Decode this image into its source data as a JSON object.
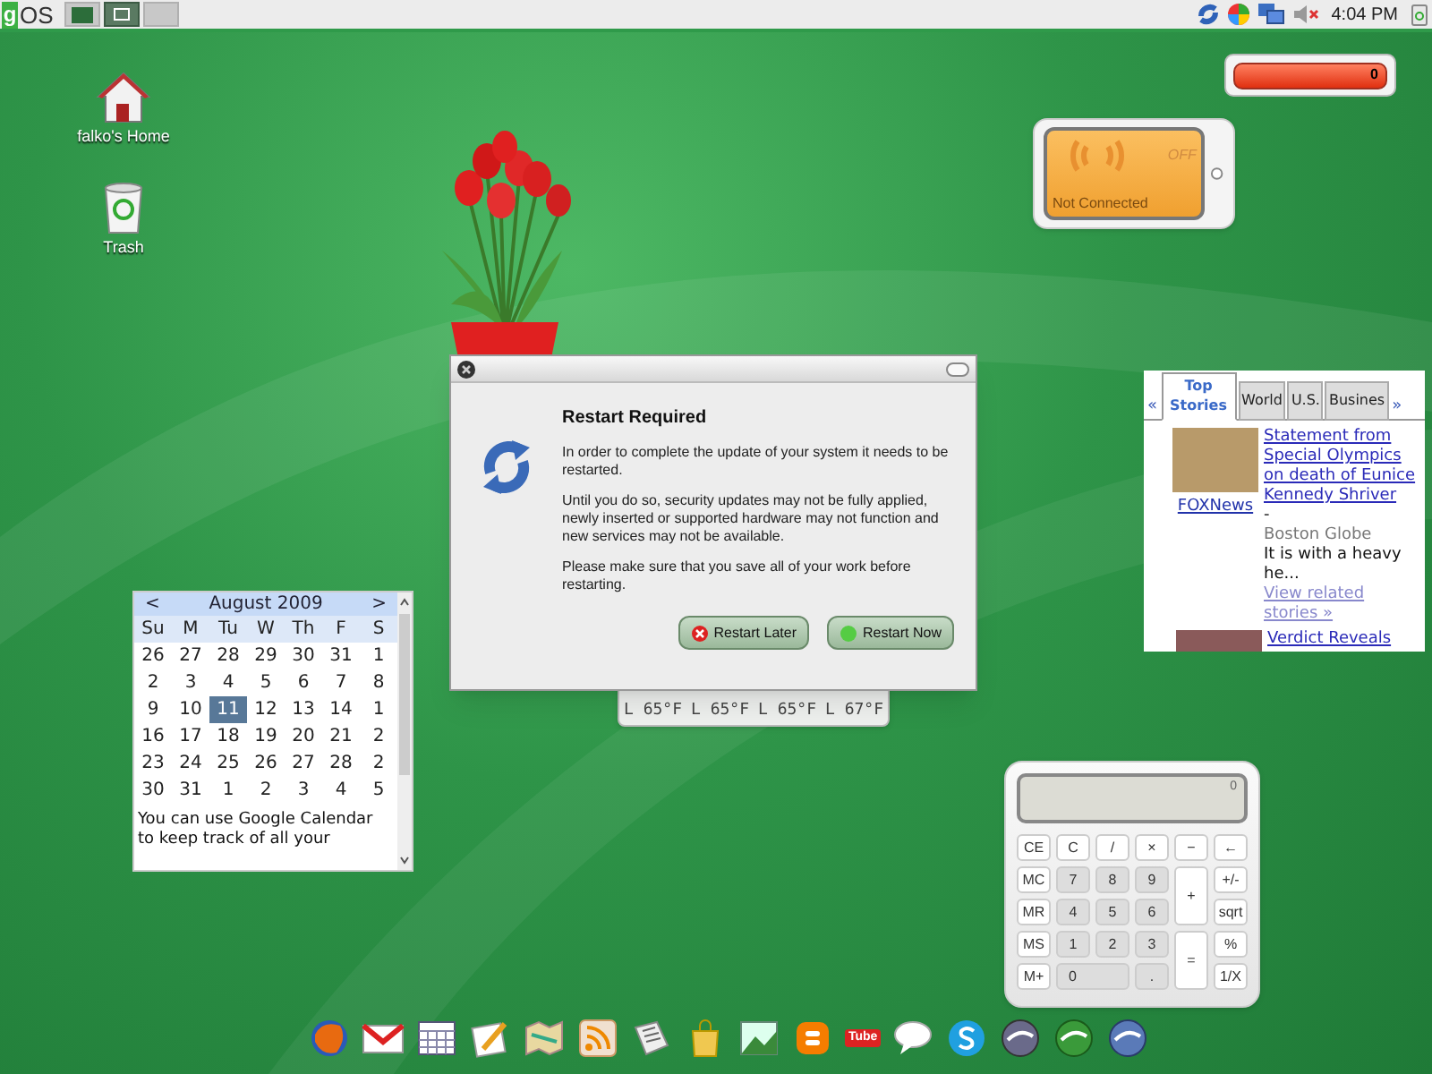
{
  "top_bar": {
    "logo_letter": "g",
    "logo_text": "OS",
    "tasks": [
      {
        "selected": false
      },
      {
        "selected": true
      },
      {
        "selected": false
      }
    ],
    "clock": "4:04 PM"
  },
  "desktop_icons": [
    {
      "label": "falko's Home",
      "kind": "home"
    },
    {
      "label": "Trash",
      "kind": "trash"
    }
  ],
  "battery_widget": {
    "reading": "0"
  },
  "wifi_widget": {
    "state": "OFF",
    "status": "Not Connected"
  },
  "dialog": {
    "title": "Restart Required",
    "paragraphs": [
      "In order to complete the update of your system it needs to be restarted.",
      "Until you do so, security updates may not be fully applied, newly inserted or supported hardware may not function and new services may not be available.",
      "Please make sure that you save all of your work before restarting."
    ],
    "buttons": [
      {
        "label": "Restart Later",
        "kind": "cancel"
      },
      {
        "label": "Restart Now",
        "kind": "confirm"
      }
    ]
  },
  "weather": {
    "lows": [
      "L 65°F",
      "L 65°F",
      "L 65°F",
      "L 67°F"
    ]
  },
  "calendar": {
    "prev": "<",
    "month": "August 2009",
    "next": ">",
    "weekdays": [
      "Su",
      "M",
      "Tu",
      "W",
      "Th",
      "F",
      "S"
    ],
    "weeks": [
      [
        {
          "day": "26",
          "selected": false
        },
        {
          "day": "27",
          "selected": false
        },
        {
          "day": "28",
          "selected": false
        },
        {
          "day": "29",
          "selected": false
        },
        {
          "day": "30",
          "selected": false
        },
        {
          "day": "31",
          "selected": false
        },
        {
          "day": "1",
          "selected": false
        }
      ],
      [
        {
          "day": "2",
          "selected": false
        },
        {
          "day": "3",
          "selected": false
        },
        {
          "day": "4",
          "selected": false
        },
        {
          "day": "5",
          "selected": false
        },
        {
          "day": "6",
          "selected": false
        },
        {
          "day": "7",
          "selected": false
        },
        {
          "day": "8",
          "selected": false
        }
      ],
      [
        {
          "day": "9",
          "selected": false
        },
        {
          "day": "10",
          "selected": false
        },
        {
          "day": "11",
          "selected": true
        },
        {
          "day": "12",
          "selected": false
        },
        {
          "day": "13",
          "selected": false
        },
        {
          "day": "14",
          "selected": false
        },
        {
          "day": "1",
          "selected": false
        }
      ],
      [
        {
          "day": "16",
          "selected": false
        },
        {
          "day": "17",
          "selected": false
        },
        {
          "day": "18",
          "selected": false
        },
        {
          "day": "19",
          "selected": false
        },
        {
          "day": "20",
          "selected": false
        },
        {
          "day": "21",
          "selected": false
        },
        {
          "day": "2",
          "selected": false
        }
      ],
      [
        {
          "day": "23",
          "selected": false
        },
        {
          "day": "24",
          "selected": false
        },
        {
          "day": "25",
          "selected": false
        },
        {
          "day": "26",
          "selected": false
        },
        {
          "day": "27",
          "selected": false
        },
        {
          "day": "28",
          "selected": false
        },
        {
          "day": "2",
          "selected": false
        }
      ],
      [
        {
          "day": "30",
          "selected": false
        },
        {
          "day": "31",
          "selected": false
        },
        {
          "day": "1",
          "selected": false
        },
        {
          "day": "2",
          "selected": false
        },
        {
          "day": "3",
          "selected": false
        },
        {
          "day": "4",
          "selected": false
        },
        {
          "day": "5",
          "selected": false
        }
      ]
    ],
    "note": "You can use Google Calendar to keep track of all your"
  },
  "news": {
    "prev": "«",
    "next": "»",
    "tabs": [
      {
        "label": "Top Stories",
        "selected": true
      },
      {
        "label": "World",
        "selected": false
      },
      {
        "label": "U.S.",
        "selected": false
      },
      {
        "label": "Busines",
        "selected": false
      }
    ],
    "source": "FOXNews",
    "headline": "Statement from Special Olympics on death of Eunice Kennedy Shriver",
    "separator": "-",
    "publisher": "Boston Globe",
    "snippet": "It is with a heavy he...",
    "related": "View related stories »",
    "next_headline": "Verdict Reveals"
  },
  "calculator": {
    "display": "0",
    "keys": [
      {
        "label": "CE",
        "kind": "func"
      },
      {
        "label": "C",
        "kind": "func"
      },
      {
        "label": "/",
        "kind": "func"
      },
      {
        "label": "×",
        "kind": "func"
      },
      {
        "label": "−",
        "kind": "func"
      },
      {
        "label": "←",
        "kind": "func"
      },
      {
        "label": "MC",
        "kind": "func"
      },
      {
        "label": "7",
        "kind": "digit"
      },
      {
        "label": "8",
        "kind": "digit"
      },
      {
        "label": "9",
        "kind": "digit"
      },
      {
        "label": "+",
        "kind": "tall"
      },
      {
        "label": "+/-",
        "kind": "func"
      },
      {
        "label": "MR",
        "kind": "func"
      },
      {
        "label": "4",
        "kind": "digit"
      },
      {
        "label": "5",
        "kind": "digit"
      },
      {
        "label": "6",
        "kind": "digit"
      },
      {
        "label": "sqrt",
        "kind": "func"
      },
      {
        "label": "MS",
        "kind": "func"
      },
      {
        "label": "1",
        "kind": "digit"
      },
      {
        "label": "2",
        "kind": "digit"
      },
      {
        "label": "3",
        "kind": "digit"
      },
      {
        "label": "=",
        "kind": "tall"
      },
      {
        "label": "%",
        "kind": "func"
      },
      {
        "label": "M+",
        "kind": "func"
      },
      {
        "label": "0",
        "kind": "wide"
      },
      {
        "label": ".",
        "kind": "digit"
      },
      {
        "label": "1/X",
        "kind": "func"
      }
    ]
  },
  "dock": {
    "video_logo": "Tube"
  }
}
